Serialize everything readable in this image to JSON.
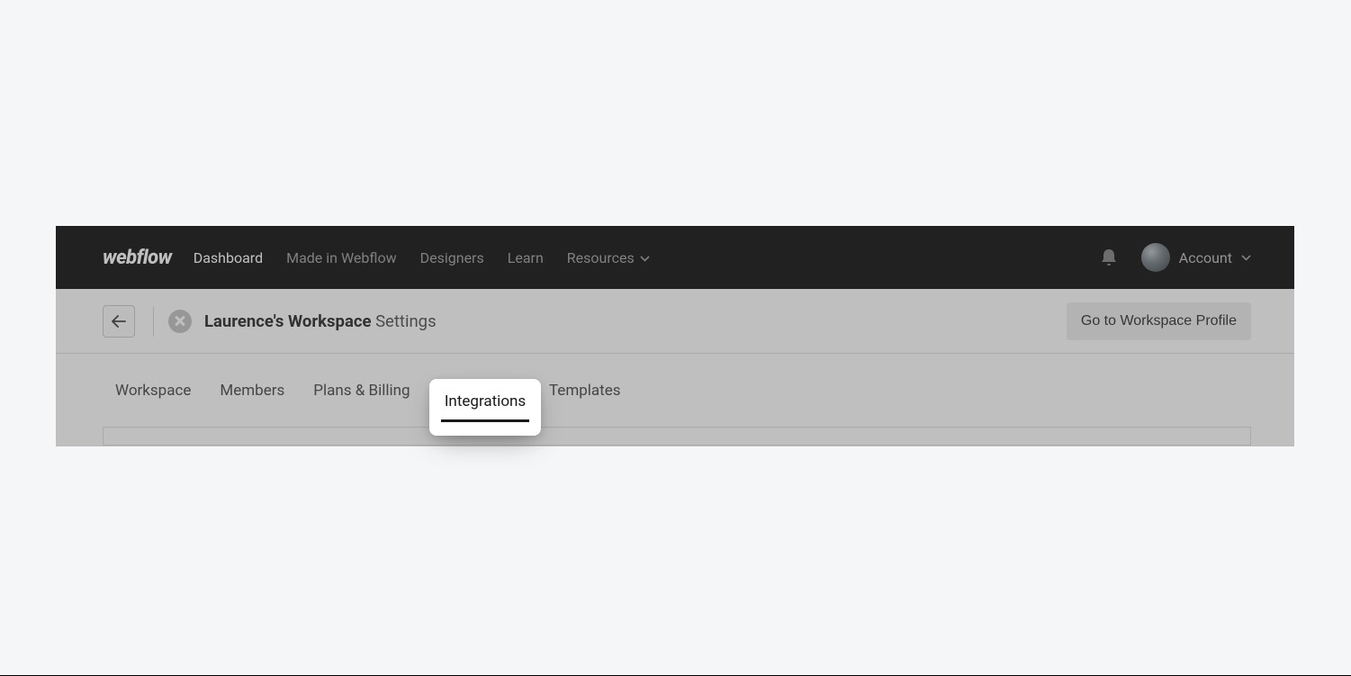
{
  "topnav": {
    "logo": "webflow",
    "items": [
      {
        "label": "Dashboard",
        "active": true
      },
      {
        "label": "Made in Webflow",
        "active": false
      },
      {
        "label": "Designers",
        "active": false
      },
      {
        "label": "Learn",
        "active": false
      },
      {
        "label": "Resources",
        "active": false,
        "dropdown": true
      }
    ],
    "account_label": "Account"
  },
  "settingsBar": {
    "workspace_name": "Laurence's Workspace",
    "page_title_suffix": "Settings",
    "profile_button": "Go to Workspace Profile"
  },
  "tabs": [
    {
      "label": "Workspace",
      "active": false
    },
    {
      "label": "Members",
      "active": false
    },
    {
      "label": "Plans & Billing",
      "active": false
    },
    {
      "label": "Integrations",
      "active": true
    },
    {
      "label": "Templates",
      "active": false
    }
  ],
  "highlight": {
    "label": "Integrations"
  }
}
